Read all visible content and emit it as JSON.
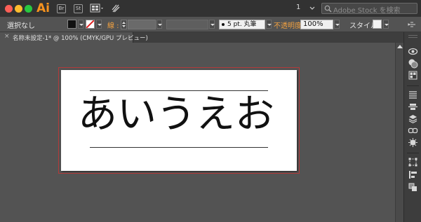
{
  "app": {
    "logo": "Ai"
  },
  "titlebar": {
    "page_number": "1",
    "stock_search_placeholder": "Adobe Stock を検索",
    "icons": [
      "bridge-icon",
      "stock-icon",
      "arrange-documents-icon",
      "gpu-performance-icon"
    ],
    "bridge_label": "Br",
    "stock_label": "St"
  },
  "controlbar": {
    "selection_label": "選択なし",
    "stroke_label": "線 :",
    "stroke_profile": "5 pt. 丸筆",
    "opacity_label": "不透明度 :",
    "opacity_value": "100%",
    "style_label": "スタイル :"
  },
  "document_tab": {
    "close": "×",
    "title": "名称未設定-1* @ 100% (CMYK/GPU プレビュー)"
  },
  "artboard": {
    "text": "あいうえお"
  },
  "colors": {
    "artboard_bleed": "#b33a3a",
    "ai_brand": "#f7931e",
    "accent_label": "#f0a040"
  },
  "dock": {
    "icons": [
      "appearance-icon",
      "color-guide-icon",
      "swatches-icon",
      "brushes-icon",
      "align-icon",
      "layers-icon",
      "links-icon",
      "symbols-icon",
      "transform-icon",
      "pathfinder-icon",
      "artboards-icon"
    ]
  }
}
